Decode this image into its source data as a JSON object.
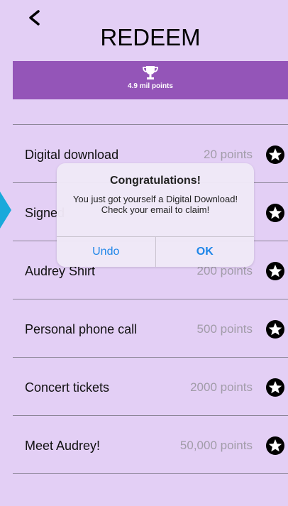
{
  "header": {
    "title": "REDEEM",
    "back_icon": "chevron-left-icon"
  },
  "banner": {
    "icon": "trophy-icon",
    "points_label": "4.9 mil points",
    "color": "#9455b8"
  },
  "rewards": [
    {
      "name": "Digital download",
      "cost": "20 points"
    },
    {
      "name": "Signed",
      "cost": ""
    },
    {
      "name": "Audrey Shirt",
      "cost": "200 points"
    },
    {
      "name": "Personal phone call",
      "cost": "500 points"
    },
    {
      "name": "Concert tickets",
      "cost": "2000 points"
    },
    {
      "name": "Meet Audrey!",
      "cost": "50,000 points"
    }
  ],
  "dialog": {
    "title": "Congratulations!",
    "message": "You just got yourself a Digital Download! Check your email to claim!",
    "undo_label": "Undo",
    "ok_label": "OK",
    "accent": "#1e86e8"
  },
  "colors": {
    "background": "#e3cff5",
    "tip": "#1aa9db"
  }
}
